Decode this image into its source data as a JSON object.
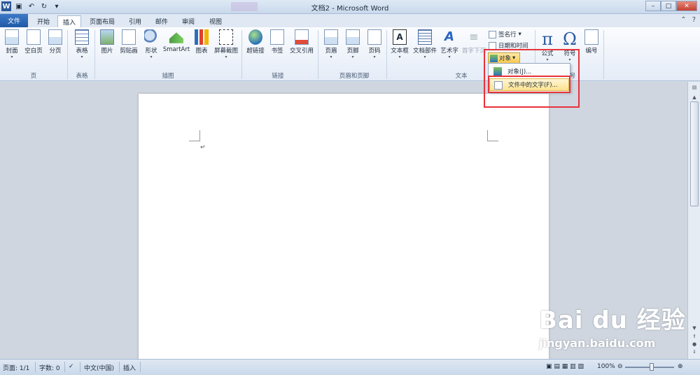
{
  "window": {
    "title": "文档2 - Microsoft Word",
    "app_icon": "W"
  },
  "tabs": [
    "文件",
    "开始",
    "插入",
    "页面布局",
    "引用",
    "邮件",
    "审阅",
    "视图"
  ],
  "ribbon": {
    "pages": {
      "group": "页",
      "cover": "封面",
      "blank": "空白页",
      "break": "分页"
    },
    "tables": {
      "group": "表格",
      "table": "表格"
    },
    "illustrations": {
      "group": "插图",
      "picture": "图片",
      "clipart": "剪贴画",
      "shapes": "形状",
      "smartart": "SmartArt",
      "chart": "图表",
      "screenshot": "屏幕截图"
    },
    "links": {
      "group": "链接",
      "hyperlink": "超链接",
      "bookmark": "书签",
      "crossref": "交叉引用"
    },
    "headerfooter": {
      "group": "页眉和页脚",
      "header": "页眉",
      "footer": "页脚",
      "pagenum": "页码"
    },
    "text": {
      "group": "文本",
      "textbox": "文本框",
      "quickparts": "文档部件",
      "wordart": "艺术字",
      "dropcap": "首字下沉",
      "signature": "签名行",
      "datetime": "日期和时间",
      "object": "对象"
    },
    "symbols": {
      "group_partial": "号",
      "equation": "公式",
      "symbol": "符号",
      "number": "编号",
      "pi": "π",
      "omega": "Ω"
    }
  },
  "object_menu": {
    "items": [
      "对象(J)...",
      "文件中的文字(F)..."
    ],
    "highlighted_index": 1
  },
  "status": {
    "page": "页面: 1/1",
    "words": "字数: 0",
    "language": "中文(中国)",
    "mode": "插入",
    "zoom": "100%"
  },
  "watermark": {
    "brand": "Bai du 经验",
    "url": "jingyan.baidu.com"
  },
  "colors": {
    "file_tab": "#1f5aa8",
    "highlight_box": "#e8323a",
    "menu_hover": "#fde28f"
  }
}
